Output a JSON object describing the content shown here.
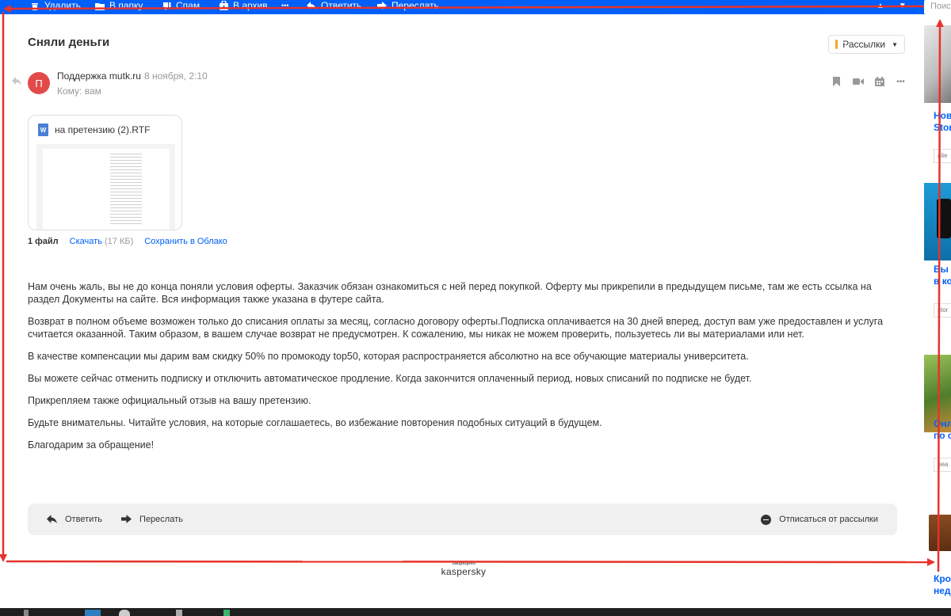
{
  "toolbar": {
    "delete_label": "Удалить",
    "to_folder_label": "В папку",
    "spam_label": "Спам",
    "archive_label": "В архив",
    "more_label": "•••",
    "reply_label": "Ответить",
    "forward_label": "Переслать",
    "search_placeholder": "Поис"
  },
  "email": {
    "subject": "Сняли деньги",
    "tag_label": "Рассылки",
    "avatar_letter": "П",
    "sender": "Поддержка mutk.ru",
    "date": "8 ноября, 2:10",
    "to": "Кому: вам"
  },
  "attachment": {
    "filename": "на претензию (2).RTF",
    "file_type_letter": "W",
    "count": "1 файл",
    "download_label": "Скачать",
    "size": "(17 КБ)",
    "save_cloud_label": "Сохранить в Облако"
  },
  "body": {
    "p1": "Нам очень жаль, вы не до конца поняли условия оферты. Заказчик обязан ознакомиться с ней перед покупкой. Оферту мы прикрепили в предыдущем письме, там же есть ссылка на раздел Документы на сайте. Вся информация также указана в футере сайта.",
    "p2": "Возврат в полном объеме возможен только до списания оплаты за месяц, согласно договору оферты.Подписка оплачивается на 30 дней вперед, доступ вам уже предоставлен и услуга считается оказанной. Таким образом, в вашем случае возврат не предусмотрен. К сожалению, мы никак не можем проверить, пользуетесь ли вы материалами или нет.",
    "p3": "В качестве компенсации мы дарим вам скидку 50% по промокоду top50, которая распространяется абсолютно на все обучающие материалы университета.",
    "p4": "Вы можете сейчас отменить подписку и отключить автоматическое продление. Когда закончится оплаченный период, новых списаний по подписке не будет.",
    "p5": "Прикрепляем также официальный отзыв на вашу претензию.",
    "p6": "Будьте внимательны. Читайте условия, на которые соглашаетесь, во избежание повторения подобных ситуаций в будущем.",
    "p7": "Благодарим за обращение!"
  },
  "reply_bar": {
    "reply_label": "Ответить",
    "forward_label": "Переслать",
    "unsubscribe_label": "Отписаться от рассылки"
  },
  "footer": {
    "protected_label": "Защищено",
    "brand": "kaspersky"
  },
  "ads": [
    {
      "title_line1": "Нов",
      "title_line2": "Stor",
      "url": "alie"
    },
    {
      "title_line1": "Вы",
      "title_line2": "в ко",
      "url": "stor"
    },
    {
      "title_line1": "Онл",
      "title_line2": "по с",
      "url": "bea"
    },
    {
      "title_line1": "Кро",
      "title_line2": "нед",
      "url": ""
    }
  ],
  "colors": {
    "toolbar_bg": "#005ff9",
    "link": "#005ff9",
    "avatar": "#e24a4a",
    "annotation": "#e8322a"
  }
}
